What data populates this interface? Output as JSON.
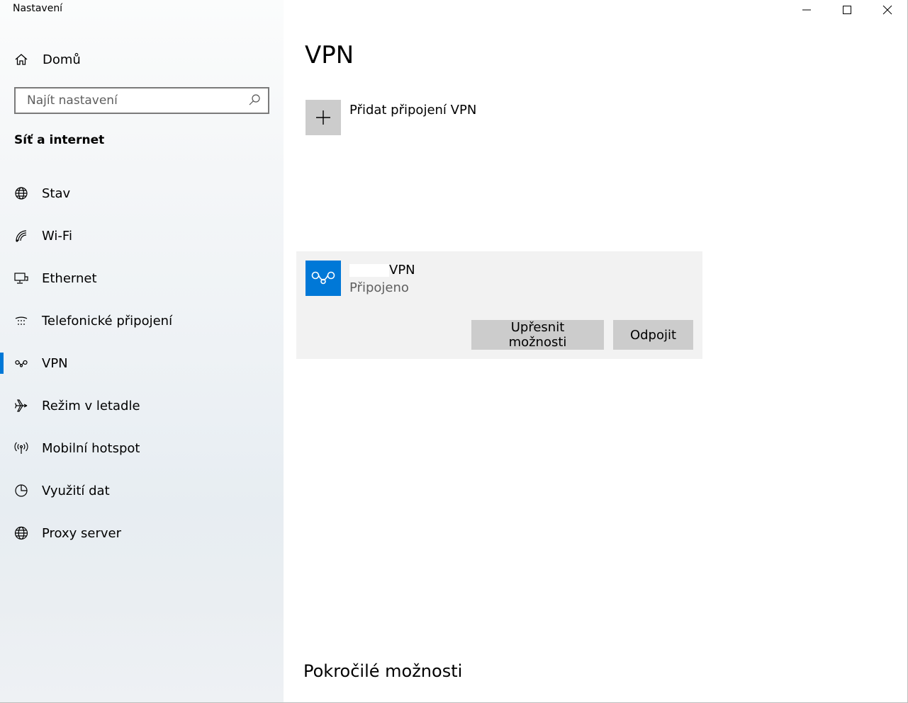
{
  "window": {
    "title": "Nastavení"
  },
  "sidebar": {
    "home_label": "Domů",
    "search_placeholder": "Najít nastavení",
    "section_title": "Síť a internet",
    "items": [
      {
        "label": "Stav",
        "icon": "globe-status-icon"
      },
      {
        "label": "Wi-Fi",
        "icon": "wifi-icon"
      },
      {
        "label": "Ethernet",
        "icon": "ethernet-icon"
      },
      {
        "label": "Telefonické připojení",
        "icon": "dialup-icon"
      },
      {
        "label": "VPN",
        "icon": "vpn-icon",
        "active": true
      },
      {
        "label": "Režim v letadle",
        "icon": "airplane-icon"
      },
      {
        "label": "Mobilní hotspot",
        "icon": "hotspot-icon"
      },
      {
        "label": "Využití dat",
        "icon": "data-usage-icon"
      },
      {
        "label": "Proxy server",
        "icon": "proxy-globe-icon"
      }
    ]
  },
  "main": {
    "title": "VPN",
    "add_label": "Přidat připojení VPN",
    "connection": {
      "name_suffix": "VPN",
      "status": "Připojeno",
      "advanced_button": "Upřesnit možnosti",
      "disconnect_button": "Odpojit"
    },
    "advanced_section_title": "Pokročilé možnosti"
  },
  "colors": {
    "accent": "#0078d7",
    "button_bg": "#cccccc",
    "card_bg": "#f2f2f2"
  }
}
